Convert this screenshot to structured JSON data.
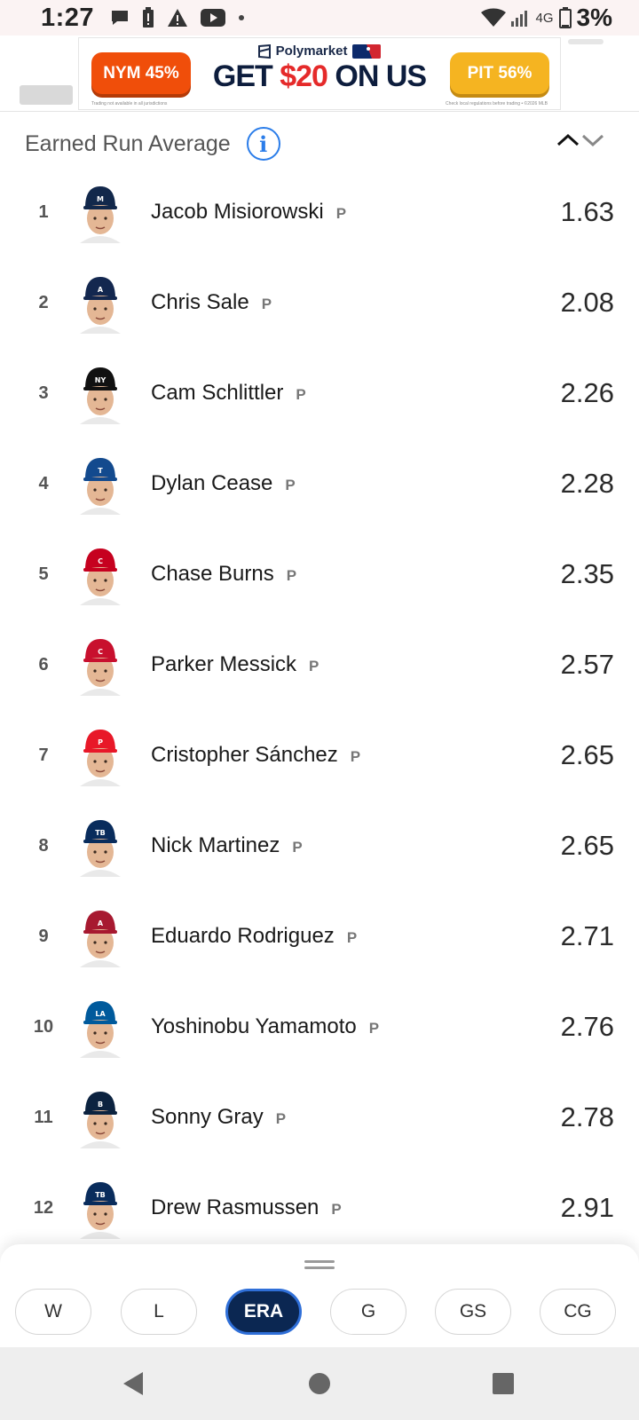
{
  "status_bar": {
    "time": "1:27",
    "network": "4G",
    "battery": "3%",
    "icons": [
      "chat-bubble-icon",
      "battery-alert-icon",
      "warning-icon",
      "youtube-icon",
      "dot-icon",
      "wifi-icon",
      "signal-icon",
      "battery-icon"
    ]
  },
  "ad": {
    "left_button": "NYM 45%",
    "brand": "Polymarket",
    "headline_prefix": "GET ",
    "headline_highlight": "$20",
    "headline_suffix": " ON US",
    "right_button": "PIT 56%",
    "fine_print_left": "Trading not available in all jurisdictions",
    "fine_print_right": "Check local regulations before trading • ©2026 MLB",
    "colors": {
      "left_button": "#f04e0a",
      "right_button": "#f5b421"
    }
  },
  "leaderboard": {
    "title": "Earned Run Average",
    "info_icon": "info-icon",
    "rows": [
      {
        "rank": "1",
        "name": "Jacob Misiorowski",
        "pos": "P",
        "value": "1.63",
        "cap": "#12284b",
        "logo": "M"
      },
      {
        "rank": "2",
        "name": "Chris Sale",
        "pos": "P",
        "value": "2.08",
        "cap": "#13274f",
        "logo": "A"
      },
      {
        "rank": "3",
        "name": "Cam Schlittler",
        "pos": "P",
        "value": "2.26",
        "cap": "#111111",
        "logo": "NY"
      },
      {
        "rank": "4",
        "name": "Dylan Cease",
        "pos": "P",
        "value": "2.28",
        "cap": "#134a8e",
        "logo": "T"
      },
      {
        "rank": "5",
        "name": "Chase Burns",
        "pos": "P",
        "value": "2.35",
        "cap": "#c6011f",
        "logo": "C"
      },
      {
        "rank": "6",
        "name": "Parker Messick",
        "pos": "P",
        "value": "2.57",
        "cap": "#c8102e",
        "logo": "C"
      },
      {
        "rank": "7",
        "name": "Cristopher Sánchez",
        "pos": "P",
        "value": "2.65",
        "cap": "#e81828",
        "logo": "P"
      },
      {
        "rank": "8",
        "name": "Nick Martinez",
        "pos": "P",
        "value": "2.65",
        "cap": "#092c5c",
        "logo": "TB"
      },
      {
        "rank": "9",
        "name": "Eduardo Rodriguez",
        "pos": "P",
        "value": "2.71",
        "cap": "#a71930",
        "logo": "A"
      },
      {
        "rank": "10",
        "name": "Yoshinobu Yamamoto",
        "pos": "P",
        "value": "2.76",
        "cap": "#005a9c",
        "logo": "LA"
      },
      {
        "rank": "11",
        "name": "Sonny Gray",
        "pos": "P",
        "value": "2.78",
        "cap": "#0c2340",
        "logo": "B"
      },
      {
        "rank": "12",
        "name": "Drew Rasmussen",
        "pos": "P",
        "value": "2.91",
        "cap": "#092c5c",
        "logo": "TB"
      }
    ]
  },
  "stat_tabs": {
    "items": [
      "W",
      "L",
      "ERA",
      "G",
      "GS",
      "CG"
    ],
    "active": "ERA",
    "colors": {
      "active_bg": "#0b2752",
      "active_border": "#2f6fd8"
    }
  },
  "nav": {
    "back": "back-icon",
    "home": "home-icon",
    "recents": "recents-icon"
  }
}
